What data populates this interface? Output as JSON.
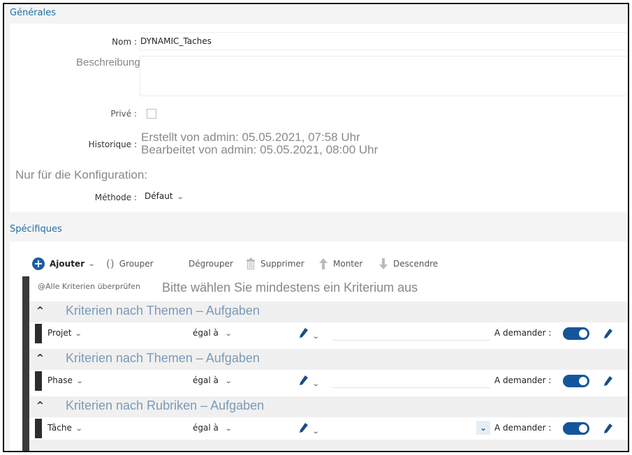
{
  "general": {
    "section_title": "Générales",
    "name_label": "Nom :",
    "name_value": "DYNAMIC_Taches",
    "description_label": "Beschreibung:",
    "description_value": "",
    "private_label": "Privé :",
    "history_label": "Historique :",
    "history_created": "Erstellt von admin: 05.05.2021, 07:58 Uhr",
    "history_edited": "Bearbeitet von admin: 05.05.2021, 08:00 Uhr",
    "config_note": "Nur für die Konfiguration:",
    "method_label": "Méthode :",
    "method_value": "Défaut"
  },
  "specific": {
    "section_title": "Spécifiques"
  },
  "toolbar": {
    "add_label": "Ajouter",
    "group_label": "Grouper",
    "ungroup_label": "Dégrouper",
    "delete_label": "Supprimer",
    "up_label": "Monter",
    "down_label": "Descendre"
  },
  "criteria": {
    "check_all_label": "@Alle Kriterien überprüfen",
    "hint": "Bitte wählen Sie mindestens ein Kriterium aus",
    "groups": [
      {
        "title": "Kriterien nach Themen – Aufgaben",
        "field": "Projet",
        "operator": "égal à",
        "ask_label": "A demander :",
        "ask_enabled": true
      },
      {
        "title": "Kriterien nach Themen – Aufgaben",
        "field": "Phase",
        "operator": "égal à",
        "ask_label": "A demander :",
        "ask_enabled": true
      },
      {
        "title": "Kriterien nach Rubriken – Aufgaben",
        "field": "Tâche",
        "operator": "égal à",
        "ask_label": "A demander :",
        "ask_enabled": true
      }
    ]
  },
  "colors": {
    "accent": "#1f6fa3",
    "toggle_on": "#15569a",
    "group_title": "#7a9ab8"
  }
}
